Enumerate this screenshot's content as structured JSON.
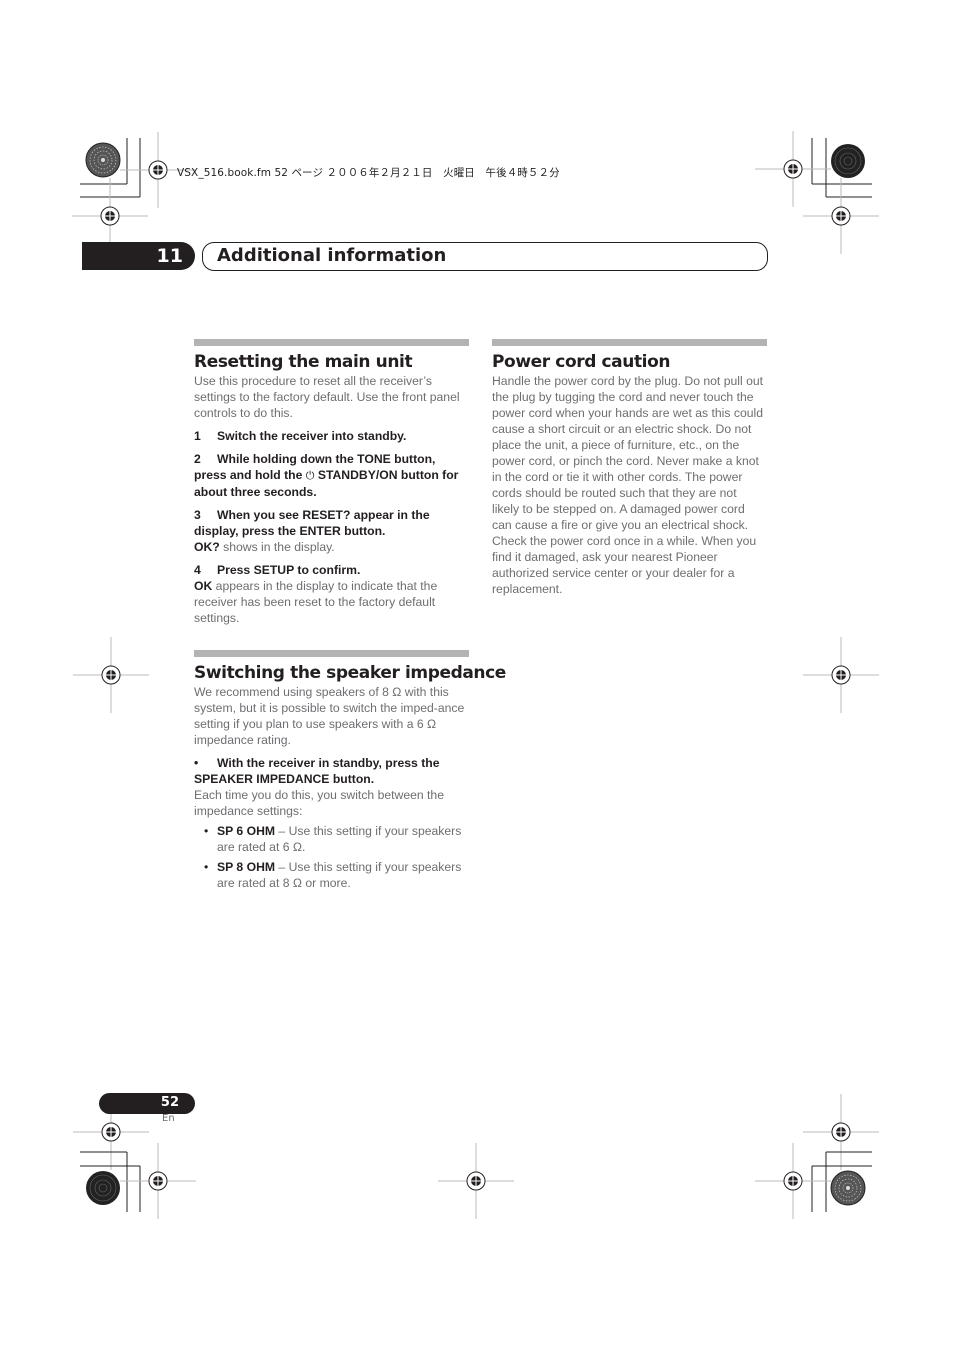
{
  "header": {
    "meta_line": "VSX_516.book.fm  52 ページ  ２００６年２月２１日　火曜日　午後４時５２分"
  },
  "chapter": {
    "number": "11",
    "title": "Additional information"
  },
  "sections": {
    "reset": {
      "title": "Resetting the main unit",
      "intro": "Use this procedure to reset all the receiver’s settings to the factory default. Use the front panel controls to do this.",
      "steps": [
        {
          "num": "1",
          "text": "Switch the receiver into standby."
        },
        {
          "num": "2",
          "text_before_icon": "While holding down the TONE button, press and hold the ",
          "icon": "⏻",
          "text_after_icon": " STANDBY/ON button for about three seconds."
        },
        {
          "num": "3",
          "text": "When you see RESET? appear in the display, press the ENTER button.",
          "note_bold": "OK?",
          "note": " shows in the display."
        },
        {
          "num": "4",
          "text": "Press SETUP to confirm.",
          "note_bold": "OK",
          "note": " appears in the display to indicate that the receiver has been reset to the factory default settings."
        }
      ]
    },
    "impedance": {
      "title": "Switching the speaker impedance",
      "intro": "We recommend using speakers of 8 Ω with this system, but it is possible to switch the imped-ance setting if you plan to use speakers with a 6 Ω impedance rating.",
      "step_bullet": "•",
      "step": "With the receiver in standby, press the SPEAKER IMPEDANCE button.",
      "after": "Each time you do this, you switch between the impedance settings:",
      "options": [
        {
          "bold": "SP 6 OHM",
          "text": " – Use this setting if your speakers are rated at 6 Ω."
        },
        {
          "bold": "SP 8 OHM",
          "text": " – Use this setting if your speakers are rated at 8 Ω or more."
        }
      ]
    },
    "power": {
      "title": "Power cord caution",
      "text": "Handle the power cord by the plug. Do not pull out the plug by tugging the cord and never touch the power cord when your hands are wet as this could cause a short circuit or an electric shock. Do not place the unit, a piece of furniture, etc., on the power cord, or pinch the cord. Never make a knot in the cord or tie it with other cords. The power cords should be routed such that they are not likely to be stepped on. A damaged power cord can cause a fire or give you an electrical shock. Check the power cord once in a while. When you find it damaged, ask your nearest Pioneer authorized service center or your dealer for a replacement."
    }
  },
  "footer": {
    "page_number": "52",
    "language": "En"
  }
}
